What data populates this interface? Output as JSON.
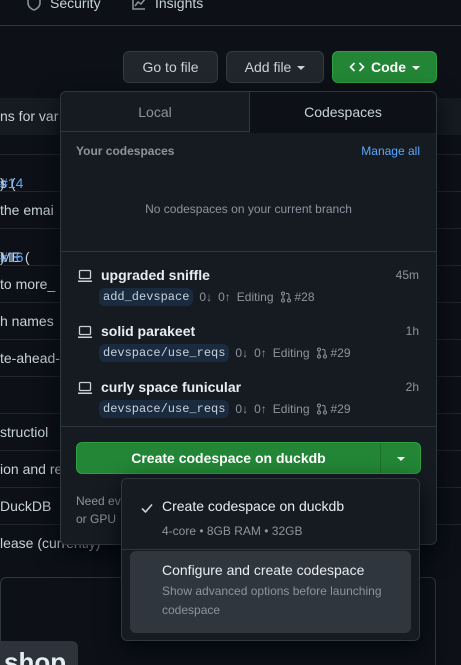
{
  "nav": {
    "security_label": "Security",
    "insights_label": "Insights"
  },
  "toolbar": {
    "go_to_file": "Go to file",
    "add_file": "Add file",
    "code": "Code"
  },
  "background": {
    "rows": [
      {
        "text": "ns for var",
        "top": 0
      },
      {
        "text": "s (",
        "link": "#14",
        "after": ")"
      },
      {
        "text": " the emai"
      },
      {
        "text": "ME (",
        "link": "#16",
        "after": ")"
      },
      {
        "text": "to more_"
      },
      {
        "text": "h names"
      },
      {
        "text": "te-ahead-"
      },
      {
        "text": ""
      },
      {
        "text": "structiol"
      },
      {
        "text": "ion and re"
      },
      {
        "text": "DuckDB"
      },
      {
        "text": "lease (currently)"
      }
    ],
    "bottom_word": "shop"
  },
  "panel": {
    "tabs": {
      "local": "Local",
      "codespaces": "Codespaces"
    },
    "header": "Your codespaces",
    "manage_all": "Manage all",
    "empty_message": "No codespaces on your current branch",
    "codespaces": [
      {
        "name": "upgraded sniffle",
        "age": "45m",
        "branch": "add_devspace",
        "behind": "0",
        "ahead": "0",
        "status": "Editing",
        "pr": "#28"
      },
      {
        "name": "solid parakeet",
        "age": "1h",
        "branch": "devspace/use_reqs",
        "behind": "0",
        "ahead": "0",
        "status": "Editing",
        "pr": "#29"
      },
      {
        "name": "curly space funicular",
        "age": "2h",
        "branch": "devspace/use_reqs",
        "behind": "0",
        "ahead": "0",
        "status": "Editing",
        "pr": "#29"
      }
    ],
    "create_button": "Create codespace on duckdb",
    "need_text_1": "Need ev",
    "need_text_2": "or GPU"
  },
  "menu": {
    "option1": {
      "title": "Create codespace on duckdb",
      "desc": "4-core • 8GB RAM • 32GB"
    },
    "option2": {
      "title": "Configure and create codespace",
      "desc": "Show advanced options before launching codespace"
    }
  },
  "colors": {
    "accent": "#238636",
    "link": "#58a6ff",
    "bg": "#0d1117",
    "panel": "#161b22"
  }
}
